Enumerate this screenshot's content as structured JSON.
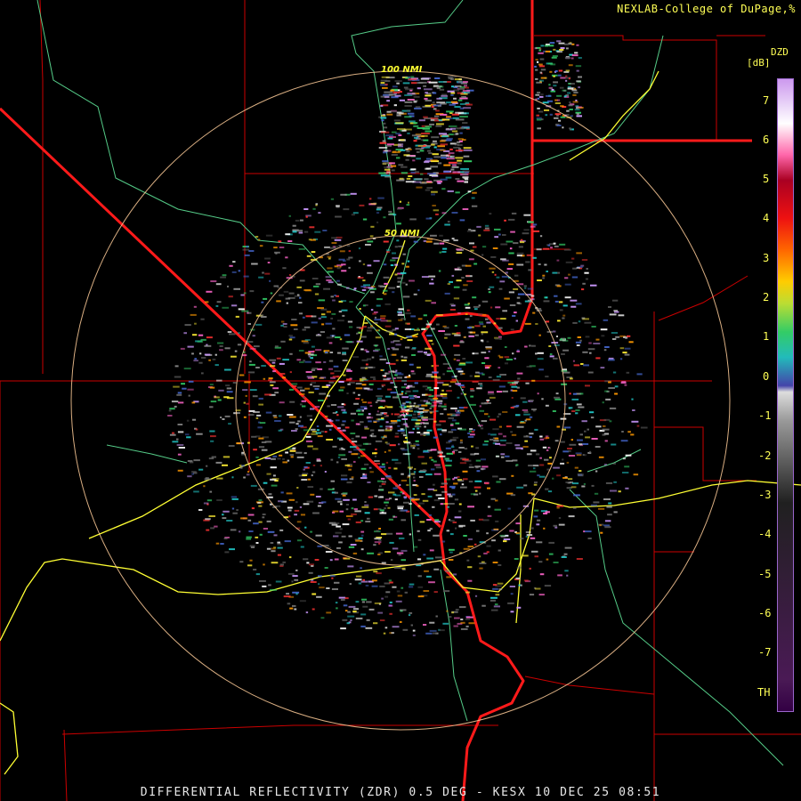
{
  "header": {
    "credit": "NEXLAB-College of DuPage,%"
  },
  "footer": {
    "caption": "DIFFERENTIAL REFLECTIVITY (ZDR) 0.5 DEG - KESX 10 DEC 25 08:51"
  },
  "range_rings": [
    {
      "label": "50 NMI",
      "range_nmi": 50
    },
    {
      "label": "100 NMI",
      "range_nmi": 100
    }
  ],
  "legend": {
    "code": "DZD",
    "unit": "[dB]",
    "ticks": [
      "7",
      "6",
      "5",
      "4",
      "3",
      "2",
      "1",
      "0",
      "-1",
      "-2",
      "-3",
      "-4",
      "-5",
      "-6",
      "-7",
      "TH"
    ],
    "min": -7.5,
    "max": 7.5
  },
  "colors": {
    "county_lines": "#cc0000",
    "state_lines": "#ff1a1a",
    "highways": "#ffff33",
    "rivers": "#55cc88",
    "range_rings": "#ffcc99",
    "credit_text": "#ffff55"
  }
}
